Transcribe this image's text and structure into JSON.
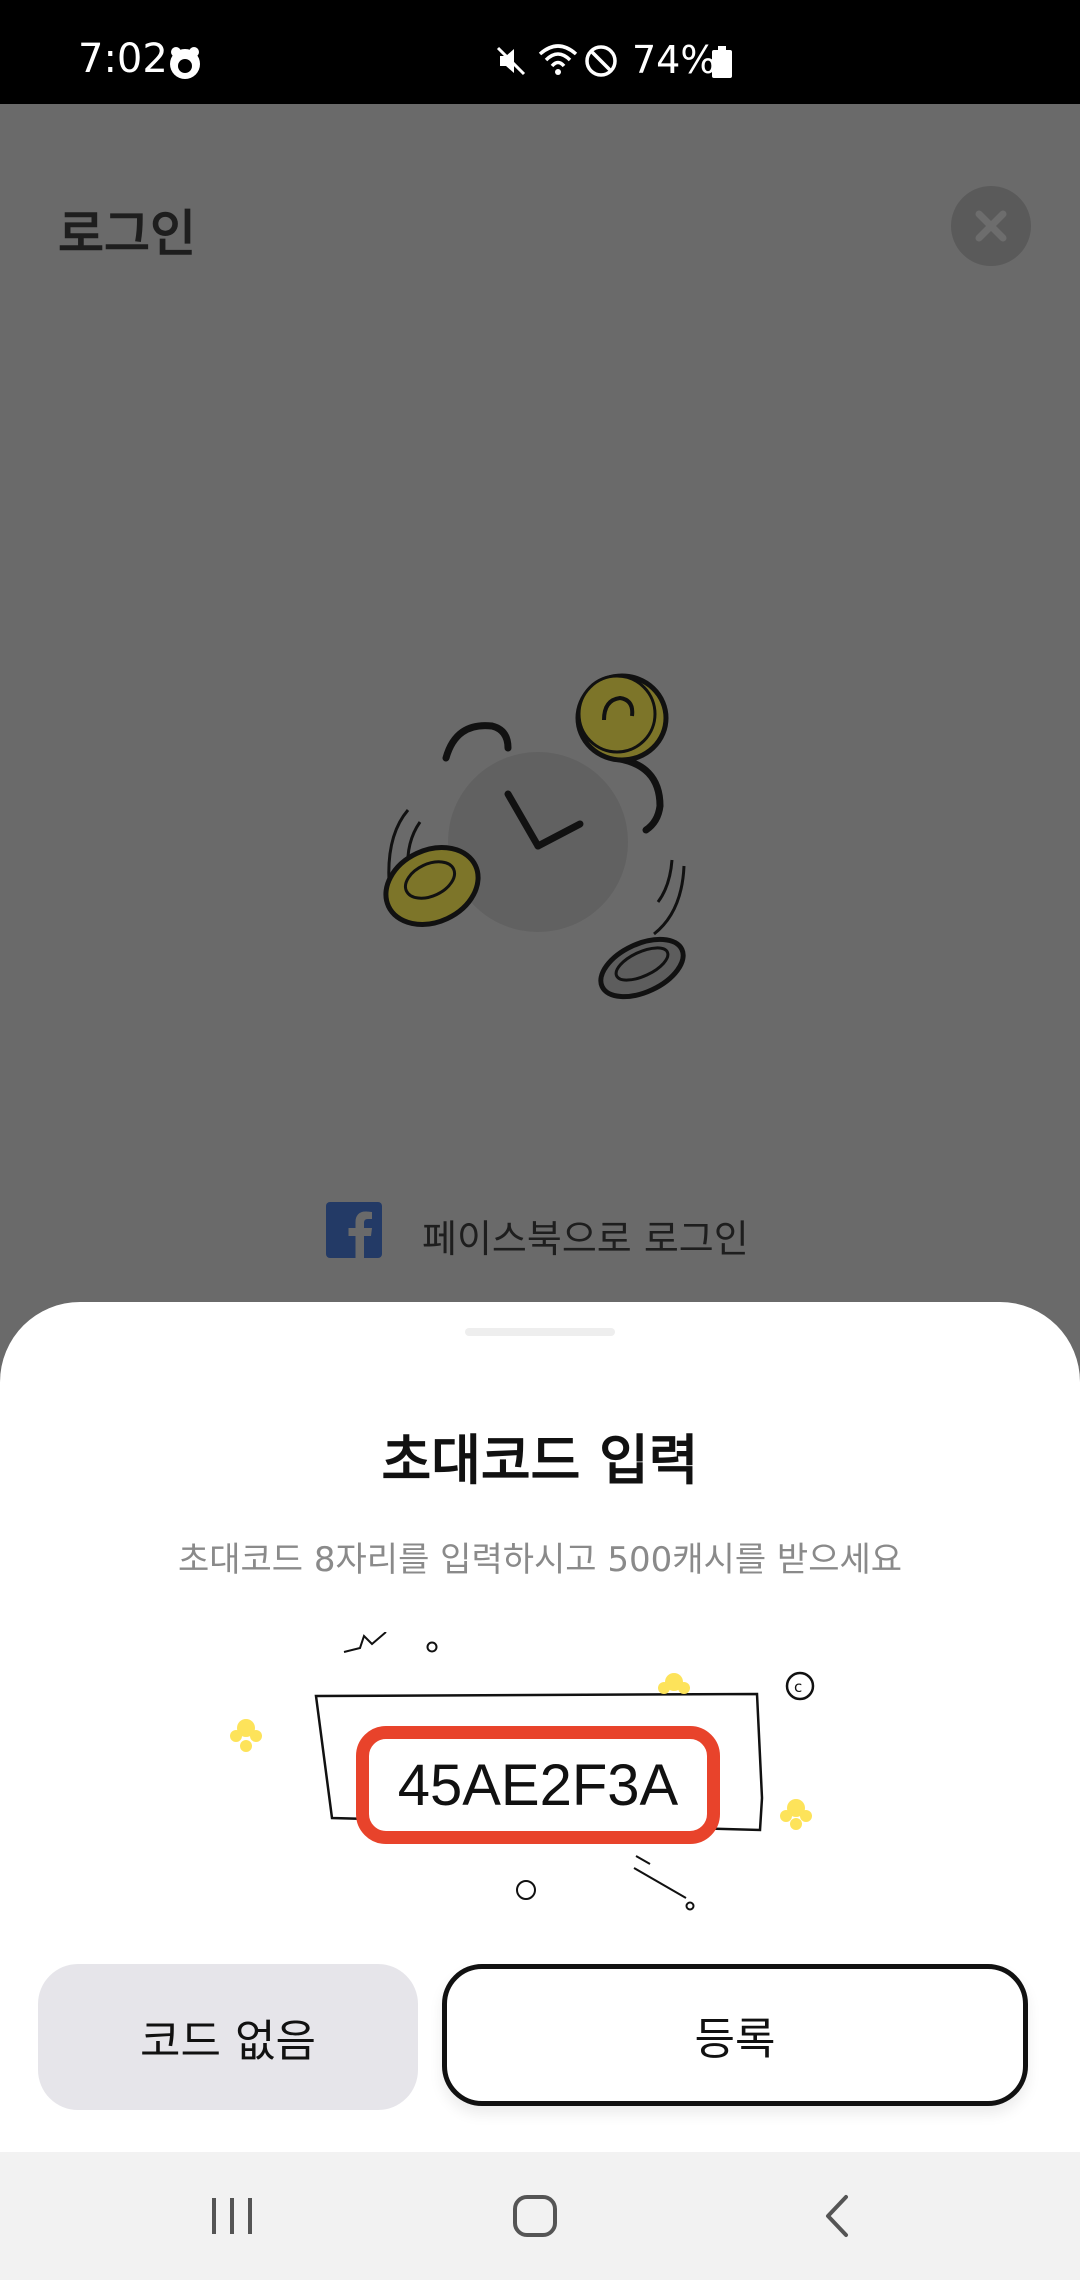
{
  "status_bar": {
    "time": "7:02",
    "battery": "74%"
  },
  "background": {
    "title": "로그인",
    "facebook_login_label": "페이스북으로 로그인"
  },
  "sheet": {
    "title": "초대코드 입력",
    "subtitle": "초대코드 8자리를 입력하시고 500캐시를 받으세요",
    "code": "45AE2F3A",
    "no_code_label": "코드 없음",
    "register_label": "등록"
  },
  "colors": {
    "overlay": "#6a6a6a",
    "code_border": "#e8432b",
    "secondary_button": "#e6e5ea",
    "facebook": "#233a66"
  }
}
